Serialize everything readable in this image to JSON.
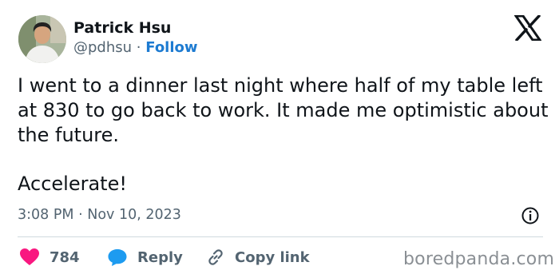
{
  "author": {
    "name": "Patrick Hsu",
    "handle": "@pdhsu",
    "separator": "·",
    "follow_label": "Follow"
  },
  "platform_icon": "x-logo-icon",
  "post": {
    "text": "I went to a dinner last night where half of my table left at 830 to go back to work. It made me optimistic about the future.",
    "closing": "Accelerate!",
    "time": "3:08 PM",
    "date_separator": "·",
    "date": "Nov 10, 2023"
  },
  "actions": {
    "likes": "784",
    "reply_label": "Reply",
    "copy_link_label": "Copy link"
  },
  "watermark": "boredpanda.com",
  "colors": {
    "accent": "#1d7bd1",
    "like": "#f91880",
    "reply": "#1d9bf0",
    "muted": "#536471",
    "text": "#0f1419"
  }
}
